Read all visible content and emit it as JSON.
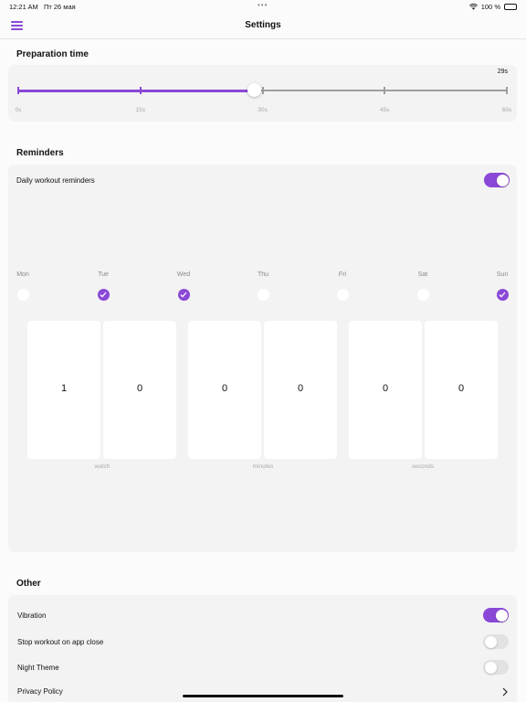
{
  "status_bar": {
    "time": "12:21 AM",
    "date": "Пт 26 мая",
    "battery": "100 %"
  },
  "header": {
    "title": "Settings"
  },
  "preparation": {
    "title": "Preparation time",
    "current_label": "29s",
    "value_seconds": 29,
    "max_seconds": 60,
    "ticks": [
      "0s",
      "15s",
      "30s",
      "45s",
      "60s"
    ]
  },
  "reminders": {
    "title": "Reminders",
    "daily_label": "Daily workout reminders",
    "daily_on": true,
    "days": [
      {
        "label": "Mon",
        "checked": false
      },
      {
        "label": "Tue",
        "checked": true
      },
      {
        "label": "Wed",
        "checked": true
      },
      {
        "label": "Thu",
        "checked": false
      },
      {
        "label": "Fri",
        "checked": false
      },
      {
        "label": "Sat",
        "checked": false
      },
      {
        "label": "Sun",
        "checked": true
      }
    ],
    "digits": [
      "1",
      "0",
      "0",
      "0",
      "0",
      "0"
    ],
    "units": [
      "watch",
      "minutes",
      "seconds"
    ]
  },
  "other": {
    "title": "Other",
    "rows": [
      {
        "label": "Vibration",
        "on": true
      },
      {
        "label": "Stop workout on app close",
        "on": false
      },
      {
        "label": "Night Theme",
        "on": false
      }
    ],
    "privacy_label": "Privacy Policy"
  },
  "colors": {
    "accent": "#8a48d6",
    "card": "#f3f3f3",
    "background": "#fbfbfb"
  }
}
